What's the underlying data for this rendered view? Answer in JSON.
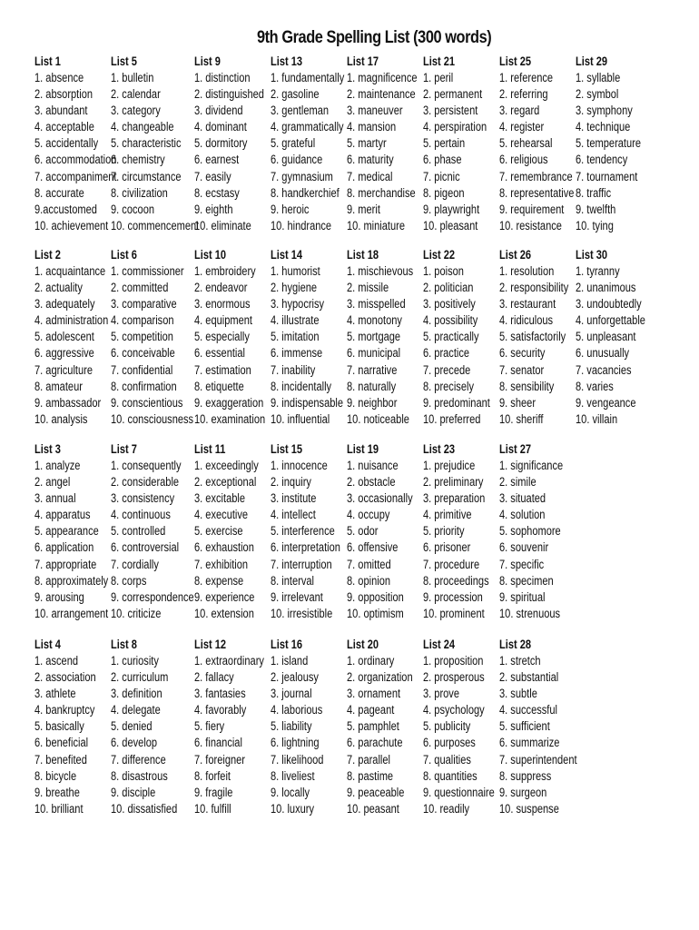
{
  "title": "9th Grade Spelling List (300 words)",
  "lists": [
    {
      "name": "List 1",
      "words": [
        "1. absence",
        "2. absorption",
        "3. abundant",
        "4. acceptable",
        "5. accidentally",
        "6. accommodation",
        "7. accompaniment",
        "8. accurate",
        "9.accustomed",
        "10. achievement"
      ]
    },
    {
      "name": "List 2",
      "words": [
        "1. acquaintance",
        "2. actuality",
        "3. adequately",
        "4. administration",
        "5. adolescent",
        "6. aggressive",
        "7. agriculture",
        "8. amateur",
        "9. ambassador",
        "10. analysis"
      ]
    },
    {
      "name": "List 3",
      "words": [
        "1. analyze",
        "2. angel",
        "3. annual",
        "4. apparatus",
        "5. appearance",
        "6. application",
        "7. appropriate",
        "8. approximately",
        "9. arousing",
        "10. arrangement"
      ]
    },
    {
      "name": "List 4",
      "words": [
        "1. ascend",
        "2. association",
        "3. athlete",
        "4. bankruptcy",
        "5. basically",
        "6. beneficial",
        "7. benefited",
        "8. bicycle",
        "9. breathe",
        "10. brilliant"
      ]
    },
    {
      "name": "List 5",
      "words": [
        "1. bulletin",
        "2. calendar",
        "3. category",
        "4. changeable",
        "5. characteristic",
        "6. chemistry",
        "7. circumstance",
        "8. civilization",
        "9. cocoon",
        "10. commencement"
      ]
    },
    {
      "name": "List 6",
      "words": [
        "1. commissioner",
        "2. committed",
        "3. comparative",
        "4. comparison",
        "5. competition",
        "6. conceivable",
        "7. confidential",
        "8. confirmation",
        "9. conscientious",
        "10. consciousness"
      ]
    },
    {
      "name": "List 7",
      "words": [
        "1. consequently",
        "2. considerable",
        "3. consistency",
        "4. continuous",
        "5. controlled",
        "6. controversial",
        "7. cordially",
        "8. corps",
        "9. correspondence",
        "10. criticize"
      ]
    },
    {
      "name": "List 8",
      "words": [
        "1. curiosity",
        "2. curriculum",
        "3. definition",
        "4. delegate",
        "5. denied",
        "6. develop",
        "7. difference",
        "8. disastrous",
        "9. disciple",
        "10. dissatisfied"
      ]
    },
    {
      "name": "List 9",
      "words": [
        "1. distinction",
        "2. distinguished",
        "3. dividend",
        "4. dominant",
        "5. dormitory",
        "6. earnest",
        "7. easily",
        "8. ecstasy",
        "9. eighth",
        "10. eliminate"
      ]
    },
    {
      "name": "List 10",
      "words": [
        "1. embroidery",
        "2. endeavor",
        "3. enormous",
        "4. equipment",
        "5. especially",
        "6. essential",
        "7. estimation",
        "8. etiquette",
        "9. exaggeration",
        "10. examination"
      ]
    },
    {
      "name": "List 11",
      "words": [
        "1. exceedingly",
        "2. exceptional",
        "3. excitable",
        "4. executive",
        "5. exercise",
        "6. exhaustion",
        "7. exhibition",
        "8. expense",
        "9. experience",
        "10. extension"
      ]
    },
    {
      "name": "List 12",
      "words": [
        "1. extraordinary",
        "2. fallacy",
        "3. fantasies",
        "4. favorably",
        "5. fiery",
        "6. financial",
        "7. foreigner",
        "8. forfeit",
        "9. fragile",
        "10. fulfill"
      ]
    },
    {
      "name": "List 13",
      "words": [
        "1. fundamentally",
        "2. gasoline",
        "3. gentleman",
        "4. grammatically",
        "5. grateful",
        "6. guidance",
        "7. gymnasium",
        "8. handkerchief",
        "9. heroic",
        "10. hindrance"
      ]
    },
    {
      "name": "List 14",
      "words": [
        "1. humorist",
        "2. hygiene",
        "3. hypocrisy",
        "4. illustrate",
        "5. imitation",
        "6. immense",
        "7. inability",
        "8. incidentally",
        "9. indispensable",
        "10. influential"
      ]
    },
    {
      "name": "List 15",
      "words": [
        "1. innocence",
        "2. inquiry",
        "3. institute",
        "4. intellect",
        "5. interference",
        "6. interpretation",
        "7.  interruption",
        "8. interval",
        "9. irrelevant",
        "10. irresistible"
      ]
    },
    {
      "name": "List 16",
      "words": [
        "1. island",
        "2. jealousy",
        "3. journal",
        "4. laborious",
        "5. liability",
        "6. lightning",
        "7. likelihood",
        "8. liveliest",
        "9. locally",
        "10. luxury"
      ]
    },
    {
      "name": "List 17",
      "words": [
        "1. magnificence",
        "2. maintenance",
        "3. maneuver",
        "4. mansion",
        "5. martyr",
        "6. maturity",
        "7. medical",
        "8. merchandise",
        "9. merit",
        "10. miniature"
      ]
    },
    {
      "name": "List 18",
      "words": [
        "1. mischievous",
        "2. missile",
        "3. misspelled",
        "4. monotony",
        "5. mortgage",
        "6. municipal",
        "7. narrative",
        "8. naturally",
        "9. neighbor",
        "10. noticeable"
      ]
    },
    {
      "name": "List 19",
      "words": [
        "1. nuisance",
        "2. obstacle",
        "3. occasionally",
        "4. occupy",
        "5. odor",
        "6. offensive",
        "7. omitted",
        "8. opinion",
        "9. opposition",
        "10. optimism"
      ]
    },
    {
      "name": "List 20",
      "words": [
        "1. ordinary",
        "2. organization",
        "3. ornament",
        "4. pageant",
        "5. pamphlet",
        "6. parachute",
        "7. parallel",
        "8. pastime",
        "9. peaceable",
        "10. peasant"
      ]
    },
    {
      "name": "List 21",
      "words": [
        "1. peril",
        "2. permanent",
        "3. persistent",
        "4. perspiration",
        "5. pertain",
        "6. phase",
        "7. picnic",
        "8. pigeon",
        "9. playwright",
        "10. pleasant"
      ]
    },
    {
      "name": "List 22",
      "words": [
        "1. poison",
        "2. politician",
        "3. positively",
        "4. possibility",
        "5. practically",
        "6. practice",
        "7. precede",
        "8. precisely",
        "9. predominant",
        "10. preferred"
      ]
    },
    {
      "name": "List 23",
      "words": [
        "1. prejudice",
        "2. preliminary",
        "3. preparation",
        "4. primitive",
        "5. priority",
        "6. prisoner",
        "7. procedure",
        "8. proceedings",
        "9. procession",
        "10. prominent"
      ]
    },
    {
      "name": "List 24",
      "words": [
        "1. proposition",
        "2. prosperous",
        "3. prove",
        "4. psychology",
        "5. publicity",
        "6. purposes",
        "7. qualities",
        "8. quantities",
        "9. questionnaire",
        "10. readily"
      ]
    },
    {
      "name": "List 25",
      "words": [
        "1. reference",
        "2. referring",
        "3. regard",
        "4. register",
        "5. rehearsal",
        "6. religious",
        "7. remembrance",
        "8. representative",
        "9. requirement",
        "10. resistance"
      ]
    },
    {
      "name": "List 26",
      "words": [
        "1. resolution",
        "2. responsibility",
        "3. restaurant",
        "4. ridiculous",
        "5. satisfactorily",
        "6. security",
        "7. senator",
        "8. sensibility",
        "9. sheer",
        "10. sheriff"
      ]
    },
    {
      "name": "List 27",
      "words": [
        "1. significance",
        "2. simile",
        "3. situated",
        "4. solution",
        "5. sophomore",
        "6. souvenir",
        "7. specific",
        "8. specimen",
        "9. spiritual",
        "10. strenuous"
      ]
    },
    {
      "name": "List 28",
      "words": [
        "1. stretch",
        "2. substantial",
        "3. subtle",
        "4. successful",
        "5. sufficient",
        "6. summarize",
        "7. superintendent",
        "8. suppress",
        "9. surgeon",
        "10. suspense"
      ]
    },
    {
      "name": "List 29",
      "words": [
        "1. syllable",
        "2. symbol",
        "3. symphony",
        "4. technique",
        "5. temperature",
        "6. tendency",
        "7. tournament",
        "8. traffic",
        "9. twelfth",
        "10. tying"
      ]
    },
    {
      "name": "List 30",
      "words": [
        "1. tyranny",
        "2. unanimous",
        "3. undoubtedly",
        "4. unforgettable",
        "5. unpleasant",
        "6. unusually",
        "7. vacancies",
        "8. varies",
        "9. vengeance",
        "10. villain"
      ]
    }
  ]
}
